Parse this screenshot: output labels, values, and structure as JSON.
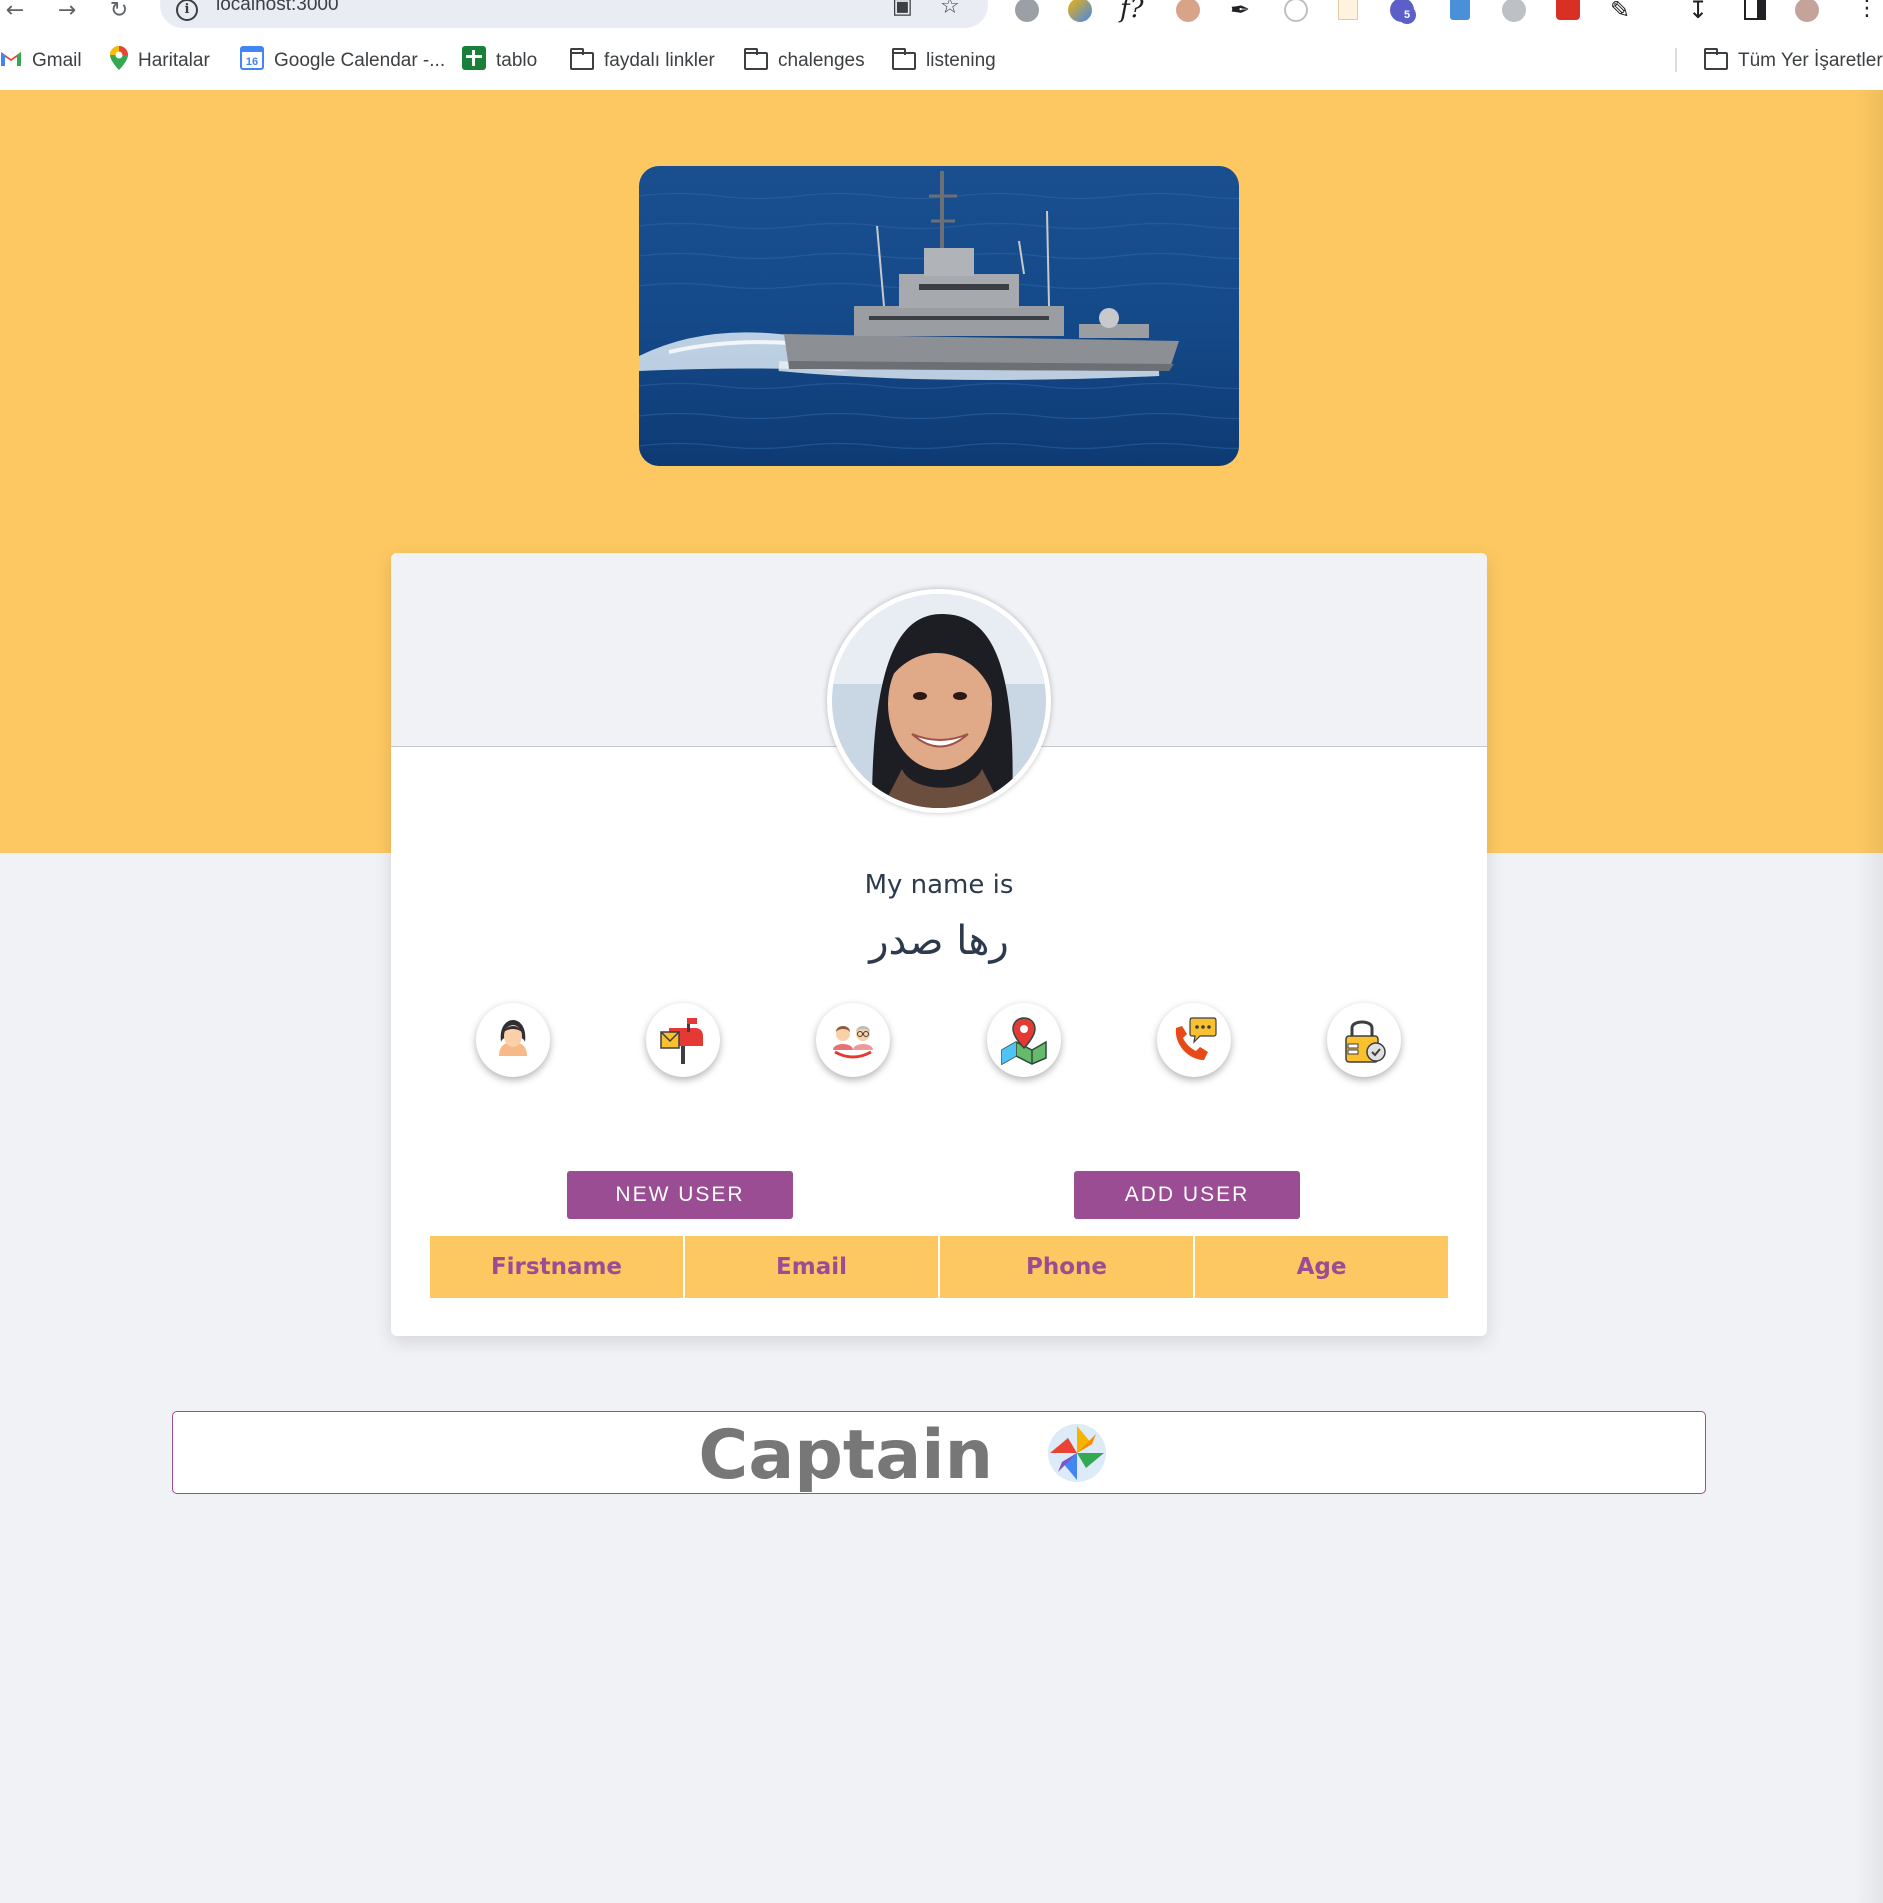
{
  "browser": {
    "url": "localhost:3000",
    "extension_badge": "5",
    "bookmarks": [
      {
        "label": "Gmail",
        "icon": "gmail-icon"
      },
      {
        "label": "Haritalar",
        "icon": "maps-icon"
      },
      {
        "label": "Google Calendar -...",
        "icon": "calendar-icon",
        "icon_text": "16"
      },
      {
        "label": "tablo",
        "icon": "sheets-icon"
      },
      {
        "label": "faydalı linkler",
        "icon": "folder-icon"
      },
      {
        "label": "chalenges",
        "icon": "folder-icon"
      },
      {
        "label": "listening",
        "icon": "folder-icon"
      }
    ],
    "all_bookmarks_label": "Tüm Yer İşaretleri"
  },
  "profile": {
    "intro": "My name is",
    "name": "رها صدر",
    "icons": [
      "user-icon",
      "mailbox-icon",
      "age-icon",
      "map-icon",
      "phone-icon",
      "lock-icon"
    ]
  },
  "buttons": {
    "new_user": "NEW USER",
    "add_user": "ADD USER"
  },
  "table": {
    "headers": [
      "Firstname",
      "Email",
      "Phone",
      "Age"
    ]
  },
  "footer": {
    "brand": "Captain"
  },
  "colors": {
    "hero": "#fdc861",
    "accent": "#9a4d92",
    "page_bg": "#f0f2f6",
    "text": "#2d3a4d"
  }
}
